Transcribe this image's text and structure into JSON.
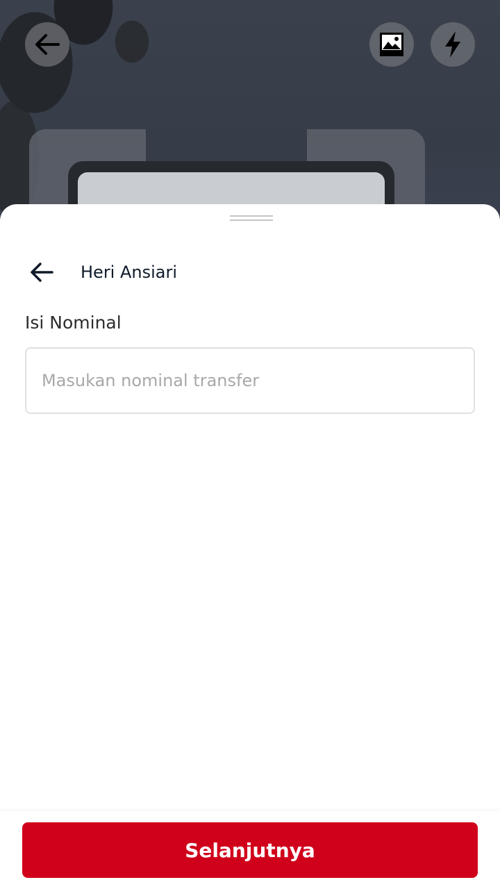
{
  "camera": {
    "back_icon": "arrow-left-icon",
    "gallery_icon": "image-icon",
    "flash_icon": "flash-icon"
  },
  "sheet": {
    "back_icon": "arrow-left-icon",
    "recipient_name": "Heri Ansiari",
    "field_label": "Isi Nominal",
    "nominal_input": {
      "value": "",
      "placeholder": "Masukan nominal transfer"
    },
    "next_label": "Selanjutnya"
  },
  "colors": {
    "primary": "#d0021b",
    "text_dark": "#0f1a2a",
    "placeholder": "#a8a8a8",
    "input_border": "#e0e0e0"
  }
}
